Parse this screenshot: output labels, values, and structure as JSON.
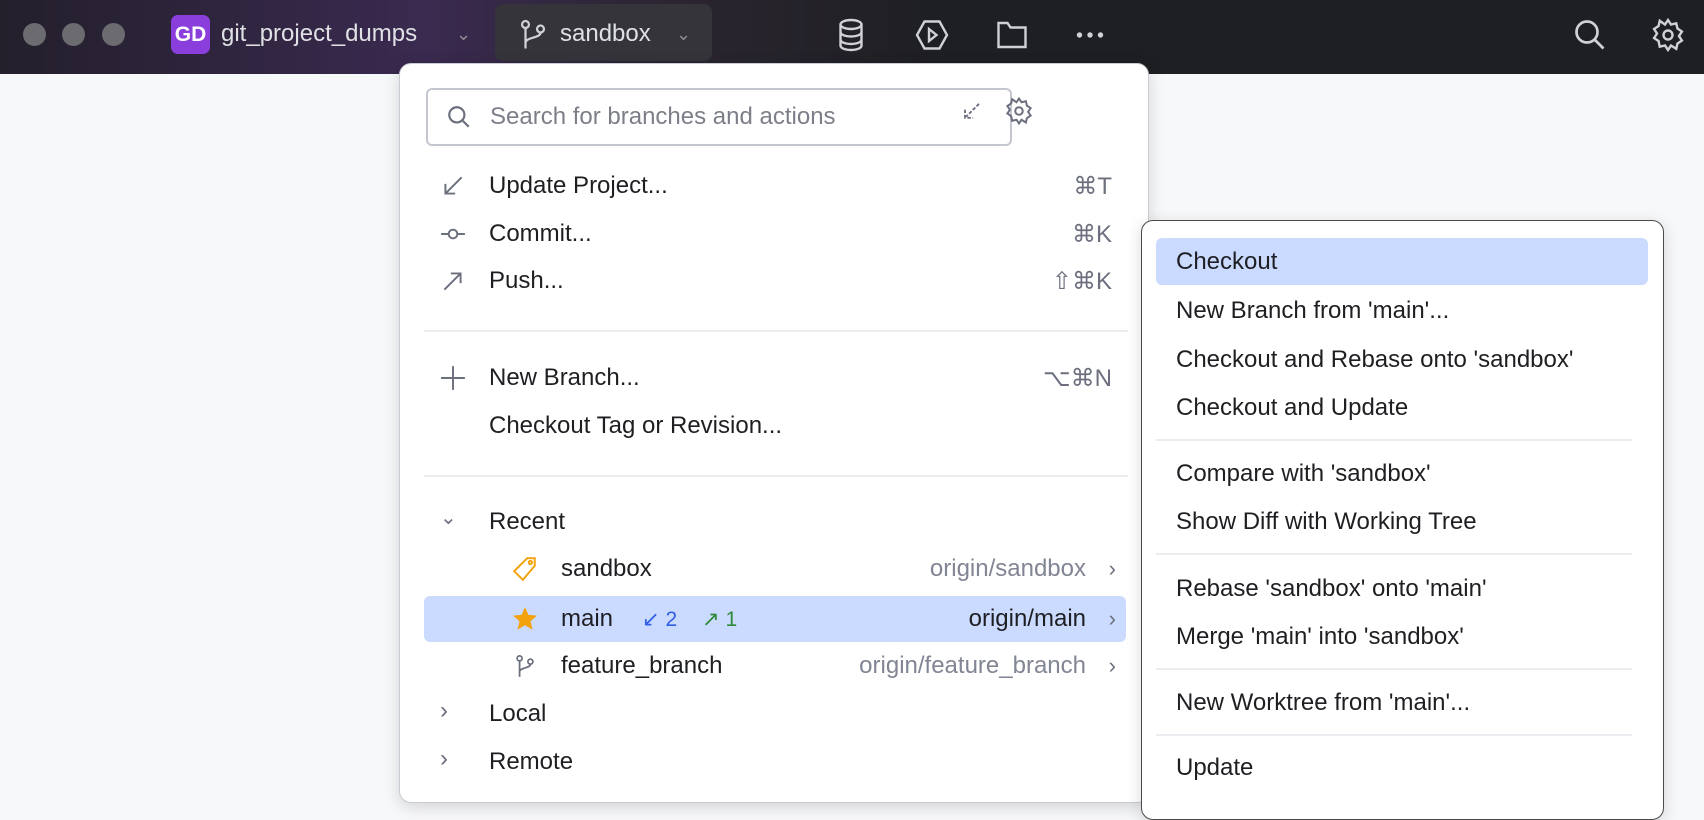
{
  "titlebar": {
    "project_initials": "GD",
    "project_name": "git_project_dumps",
    "branch": "sandbox"
  },
  "popup": {
    "search_placeholder": "Search for branches and actions",
    "actions": [
      {
        "label": "Update Project...",
        "shortcut": "⌘T",
        "icon": "update-arrow-icon"
      },
      {
        "label": "Commit...",
        "shortcut": "⌘K",
        "icon": "commit-icon"
      },
      {
        "label": "Push...",
        "shortcut": "⇧⌘K",
        "icon": "push-arrow-icon"
      },
      {
        "label": "New Branch...",
        "shortcut": "⌥⌘N",
        "icon": "plus-icon"
      },
      {
        "label": "Checkout Tag or Revision...",
        "shortcut": ""
      }
    ],
    "groups": {
      "recent": "Recent",
      "local": "Local",
      "remote": "Remote"
    },
    "branches": [
      {
        "name": "sandbox",
        "remote": "origin/sandbox",
        "icon": "tag-icon"
      },
      {
        "name": "main",
        "remote": "origin/main",
        "icon": "star-icon",
        "incoming": "2",
        "outgoing": "1",
        "selected": true
      },
      {
        "name": "feature_branch",
        "remote": "origin/feature_branch",
        "icon": "branch-icon"
      }
    ]
  },
  "submenu": [
    "Checkout",
    "New Branch from 'main'...",
    "Checkout and Rebase onto 'sandbox'",
    "Checkout and Update",
    "Compare with 'sandbox'",
    "Show Diff with Working Tree",
    "Rebase 'sandbox' onto 'main'",
    "Merge 'main' into 'sandbox'",
    "New Worktree from 'main'...",
    "Update"
  ],
  "colors": {
    "selection": "#cbdaff",
    "badge": "#8a3fdc",
    "incoming": "#2f5fe0",
    "outgoing": "#2e8a3a",
    "star": "#f4a20c"
  }
}
